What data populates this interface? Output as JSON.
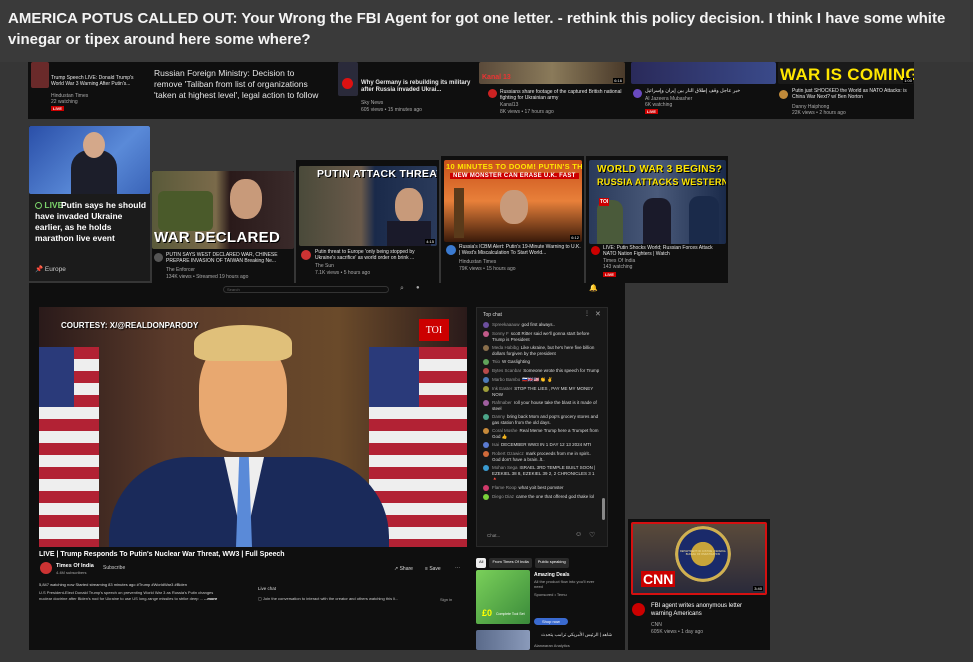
{
  "window": {
    "title": "AMERICA POTUS CALLED OUT: Your Wrong the FBI Agent for got one letter.   - rethink this policy decision. I think I have some white vinegar or tipex around here some where?"
  },
  "top_row": [
    {
      "title": "Trump Speech LIVE: Donald Trump's World War 3 Warning After Putin's...",
      "channel": "Hindustan Times",
      "meta": "22 watching",
      "badge": "LIVE"
    },
    {
      "title": "Russian Foreign Ministry: Decision to remove 'Taliban from list of organizations 'taken at highest level', legal action to follow"
    },
    {
      "title": "Why Germany is rebuilding its military after Russia invaded Ukrai...",
      "channel": "Sky News",
      "meta": "605 views • 15 minutes ago"
    },
    {
      "title": "Russians share footage of the captured British national fighting for Ukrainian army",
      "channel": "Kanal13",
      "meta": "8K views • 17 hours ago",
      "logo": "Kanal 13",
      "duration": "6:16"
    },
    {
      "title": "خبر عاجل وقف إطلاق النار بين إيران وإسرائيل",
      "channel": "Al Jazeera Mubasher",
      "meta": "6K watching",
      "badge": "LIVE"
    },
    {
      "title": "Putin just SHOCKED the World as NATO Attacks: is China War Next? w/ Ben Norton",
      "channel": "Danny Haiphong",
      "meta": "22K views • 2 hours ago",
      "headline": "WAR IS COMING!",
      "duration": "1:00"
    }
  ],
  "putin_card": {
    "live_label": "LIVE",
    "title": "Putin says he should have invaded Ukraine earlier, as he holds marathon live event",
    "tag": "Europe"
  },
  "mid_row": [
    {
      "headline": "WAR DECLARED",
      "title": "PUTIN SAYS WEST DECLARED WAR, CHINESE PREPARE INVASION OF TAIWAN Breaking Ne...",
      "channel": "The Enforcer",
      "meta": "134K views • Streamed 19 hours ago"
    },
    {
      "headline": "PUTIN ATTACK THREAT",
      "title": "Putin threat to Europe 'only being stopped by Ukraine's sacrifice' as world order on brink ...",
      "channel": "The Sun",
      "meta": "7.1K views • 5 hours ago",
      "duration": "4:15"
    },
    {
      "headline": "10 MINUTES TO DOOM! PUTIN'S THIS",
      "sub_headline": "NEW MONSTER CAN ERASE U.K. FAST",
      "title": "Russia's ICBM Alert: Putin's 19-Minute Warning to U.K. | West's Miscalculation To Start World...",
      "channel": "Hindustan Times",
      "meta": "79K views • 15 hours ago",
      "duration": "6:12"
    },
    {
      "headline": "WORLD WAR 3 BEGINS?",
      "sub_headline": "RUSSIA ATTACKS WESTERN...",
      "title": "LIVE: Putin Shocks World; Russian Forces Attack NATO Nation Fighters | Watch",
      "channel": "Times Of India",
      "meta": "143 watching",
      "badge": "LIVE",
      "logo": "TOI"
    }
  ],
  "player": {
    "search_placeholder": "Search",
    "watermark": "COURTESY: X/@REALDONPARODY",
    "logo": "TOI",
    "video_title": "LIVE | Trump Responds To Putin's Nuclear War Threat, WW3 | Full Speech",
    "channel": "Times Of India",
    "subscribers": "4.4M subscribers",
    "subscribe_label": "Subscribe",
    "share_label": "Share",
    "save_label": "Save",
    "desc_meta": "5,847 watching now  Started streaming 83 minutes ago  #Trump #WorldWar3 #Biden",
    "desc_line1": "U.S President-Elect Donald Trump's speech on preventing World War 3 as Russia's Putin changes",
    "desc_line2": "nuclear doctrine after Biden's nod for Ukraine to use US long-range missiles to strike deep ...",
    "more_label": "...more",
    "livechat_label": "Live chat",
    "join_text": "Join the conversation to interact with the creator and others watching this li...",
    "sign_in": "Sign in"
  },
  "chat": {
    "header": "Top chat",
    "input_placeholder": "Chat...",
    "messages": [
      {
        "user": "Spreekaaauw",
        "text": "god first always..",
        "color": "#6c4f9e"
      },
      {
        "user": "Sonny F",
        "text": "scott Ritter said we'll gonna start before Trump is President",
        "color": "#c15a8a"
      },
      {
        "user": "Meda Habibg",
        "text": "Like ukraine, but he's here five billion dollars forgiven by the president",
        "color": "#8a6f4c"
      },
      {
        "user": "Tsio",
        "text": "W Gaslighting",
        "color": "#5fa35a"
      },
      {
        "user": "Bytes Scanbar",
        "text": "Someone wrote this speech for Trump",
        "color": "#b84a4a"
      },
      {
        "user": "Marbo Bambo",
        "text": "🇷🇺🇬🇧🇺🇸 👏 ✌️",
        "color": "#4d7ab8"
      },
      {
        "user": "Ink Easter",
        "text": "STOP THE LIES , PAY ME MY MONEY NOW",
        "color": "#9e9e3a"
      },
      {
        "user": "Rafmaber",
        "text": "roll your house take the blast is it made of steel",
        "color": "#a05fa0"
      },
      {
        "user": "Danny",
        "text": "bring back Mom and pop's grocery stores and gas station from the old days.",
        "color": "#4ca58a"
      },
      {
        "user": "Coral Moshe",
        "text": "Real Meme Trump here a Trumpet from God 👍",
        "color": "#c78a3a"
      },
      {
        "user": "Isai",
        "text": "DECEMBER WW3 IN 1 DAY 12 13 2024 MTI",
        "color": "#5a7ad0"
      },
      {
        "user": "Robert Ozawicz",
        "text": "mark proceeds from me in spirit.. God don't have a brain..lt..",
        "color": "#d06a3a"
      },
      {
        "user": "Mohan Sega",
        "text": "ISRAEL 3RD TEMPLE BUILT SOON | EZEKIEL 38 8, EZEKIEL 39 2, 2 CHRONICLES 3 1 🔺",
        "color": "#3a9ad0"
      },
      {
        "user": "Flame Roop",
        "text": "what yoit best pomster",
        "color": "#d03a6a"
      },
      {
        "user": "Diego Diaz",
        "text": "came the one that offered god thake lol",
        "color": "#7ad03a"
      }
    ]
  },
  "sidebar": {
    "tabs": [
      "All",
      "From Times Of India",
      "Public speaking"
    ],
    "ad_title": "Amazing Deals",
    "ad_text": "All the product flow into you'll ever need",
    "ad_sponsor": "Sponsored • Temu",
    "ad_button": "Shop now",
    "ad_badge": "Complete Tool Set",
    "second_title": "شاهد | الرئيس الأمريكي ترامب يتحدث",
    "second_channel": "Alanwaran Analytics"
  },
  "fbi_card": {
    "title": "FBI agent writes anonymous letter warning Americans",
    "channel": "CNN",
    "meta": "605K views • 1 day ago",
    "duration": "3:40",
    "logo": "CNN",
    "seal_text": "DEPARTMENT OF JUSTICE • FEDERAL BUREAU OF INVESTIGATION"
  },
  "colors": {
    "youtube_red": "#ff0000",
    "live_red": "#ff4e45",
    "page_bg": "#363636",
    "card_bg": "#0f0f0f",
    "fbi_border": "#d51010"
  }
}
